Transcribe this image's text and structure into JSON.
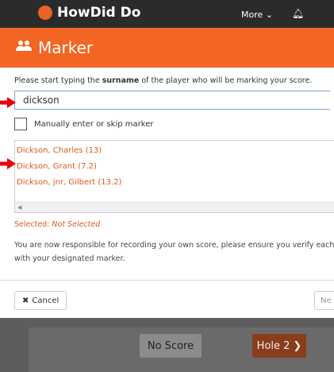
{
  "app": {
    "logo_text": "HowDid Do",
    "more_label": "More ⌄",
    "bell_icon": "bell-icon"
  },
  "background": {
    "no_score_label": "No Score",
    "hole_label": "Hole 2",
    "hole_icon": "chevron-right-icon"
  },
  "modal": {
    "title": "Marker",
    "title_icon": "users-icon",
    "instructions_prefix": "Please start typing the ",
    "instructions_bold": "surname",
    "instructions_suffix": " of the player who will be marking your score.",
    "search_value": "dickson",
    "manual_label": "Manually enter or skip marker",
    "results": [
      "Dickson, Charles (13)",
      "Dickson, Grant (7.2)",
      "Dickson, jnr, Gilbert (13.2)"
    ],
    "selected_prefix": "Selected: ",
    "selected_value": "Not Selected",
    "notice_line1": "You are now responsible for recording your own score, please ensure you verify each hole s",
    "notice_line2": "with your designated marker.",
    "cancel_label": "Cancel",
    "next_label": "Ne"
  },
  "colors": {
    "brand": "#f26522",
    "link": "#d95a1c",
    "annotation_arrow": "#e8000b"
  }
}
